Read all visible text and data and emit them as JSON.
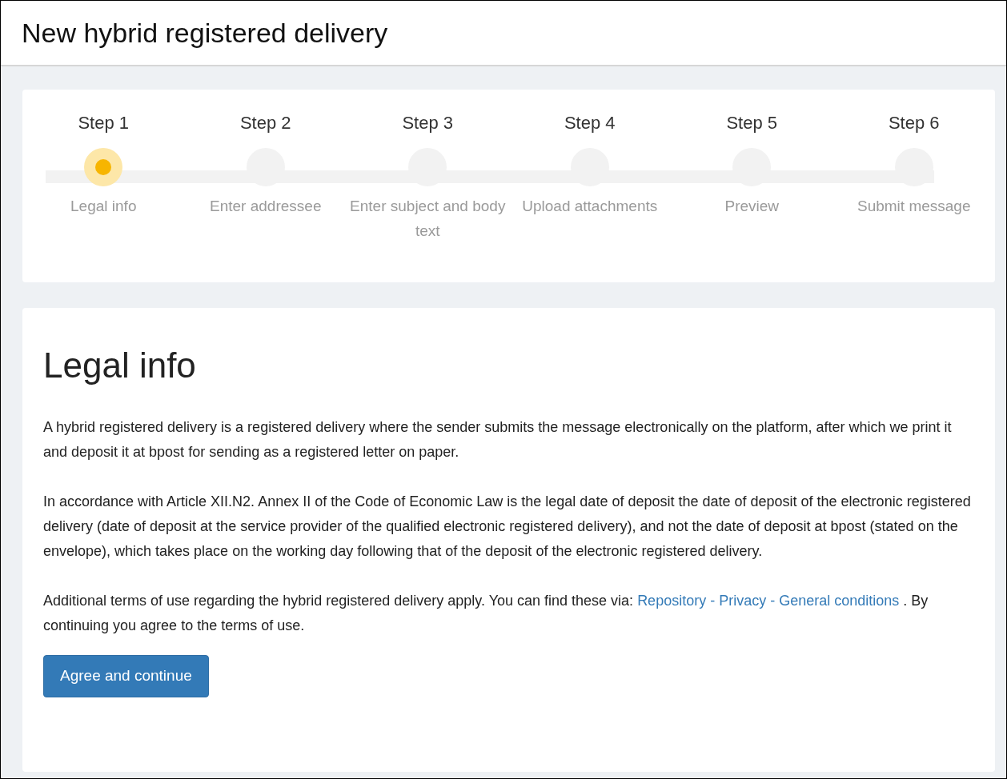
{
  "page": {
    "title": "New hybrid registered delivery"
  },
  "steps": [
    {
      "label": "Step 1",
      "caption": "Legal info",
      "selected": true
    },
    {
      "label": "Step 2",
      "caption": "Enter addressee",
      "selected": false
    },
    {
      "label": "Step 3",
      "caption": "Enter subject and body text",
      "selected": false
    },
    {
      "label": "Step 4",
      "caption": "Upload attachments",
      "selected": false
    },
    {
      "label": "Step 5",
      "caption": "Preview",
      "selected": false
    },
    {
      "label": "Step 6",
      "caption": "Submit message",
      "selected": false
    }
  ],
  "section": {
    "heading": "Legal info",
    "paragraphs": [
      "A hybrid registered delivery is a registered delivery where the sender submits the message electronically on the platform, after which we print it and deposit it at bpost for sending as a registered letter on paper.",
      "In accordance with Article XII.N2. Annex II of the Code of Economic Law is the legal date of deposit the date of deposit of the electronic registered delivery (date of deposit at the service provider of the qualified electronic registered delivery), and not the date of deposit at bpost (stated on the envelope), which takes place on the working day following that of the deposit of the electronic registered delivery."
    ],
    "terms": {
      "before": "Additional terms of use regarding the hybrid registered delivery apply. You can find these via:",
      "link": "Repository - Privacy - General conditions",
      "after": ". By continuing you agree to the terms of use."
    },
    "button": "Agree and continue"
  }
}
